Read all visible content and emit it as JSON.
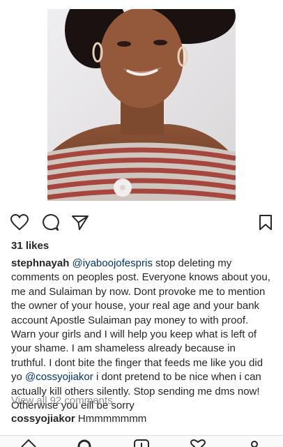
{
  "post": {
    "likes": "31 likes",
    "caption": {
      "username": "stephnayah",
      "mention1": "@iyaboojofespris",
      "text1": " stop deleting my comments on peoples post.  Everyone knows about you, me and Sulaiman by now. Dont provoke me to mention the owner of your house, your real age and your bank account Apostle Sulaiman pay money to with proof. Warn your girls and I will help you keep what is left of your shame. I am shameless already because in truthful. I dont bite the finger that feeds me  like you did yo ",
      "mention2": "@cossyojiakor",
      "text2": " i dont pretend to be nice when i can actually kill others silently. Stop sending me dms now! Otherwise you eill be sorry"
    },
    "view_all_comments": "View all 92 comments",
    "comment": {
      "username": "cossyojiakor",
      "text": " Hmmmmmmm"
    }
  },
  "icons": {
    "like": "heart-icon",
    "comment": "comment-bubble-icon",
    "share": "paper-plane-icon",
    "save": "bookmark-icon",
    "nav": [
      "home-icon",
      "search-icon",
      "add-icon",
      "activity-heart-icon",
      "profile-icon"
    ]
  },
  "colors": {
    "text": "#262626",
    "mention": "#003569",
    "muted": "#8e8e8e",
    "border": "#dbdbdb"
  }
}
